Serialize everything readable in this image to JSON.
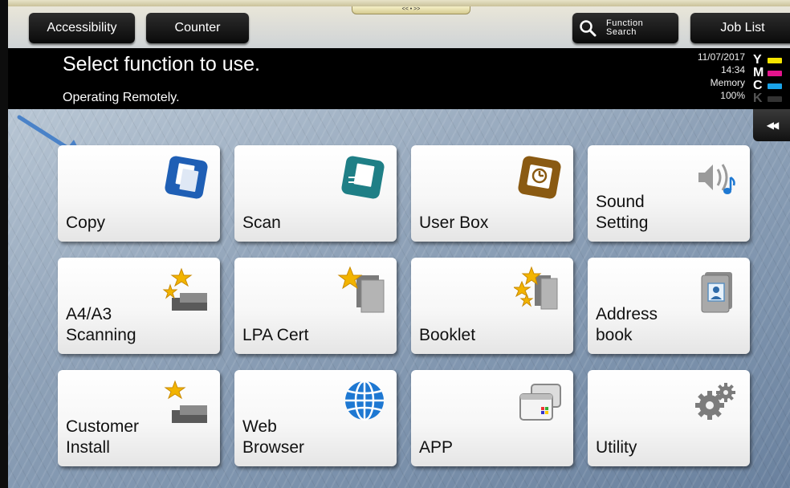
{
  "topbar": {
    "accessibility_label": "Accessibility",
    "counter_label": "Counter",
    "function_search_line1": "Function",
    "function_search_line2": "Search",
    "job_list_label": "Job List",
    "handle_glyph": "<< • >>"
  },
  "message": {
    "title": "Select function to use.",
    "subtitle": "Operating Remotely."
  },
  "status": {
    "date": "11/07/2017",
    "time": "14:34",
    "memory_label": "Memory",
    "memory_value": "100%"
  },
  "toner": [
    {
      "letter": "Y",
      "color": "#f5e400"
    },
    {
      "letter": "M",
      "color": "#e3148d"
    },
    {
      "letter": "C",
      "color": "#1aa3e8"
    },
    {
      "letter": "K",
      "color": "#333333"
    }
  ],
  "collapse_glyph": "◀◀",
  "tiles": [
    {
      "label": "Copy",
      "icon": "copy-icon"
    },
    {
      "label": "Scan",
      "icon": "scan-icon"
    },
    {
      "label": "User Box",
      "icon": "user-box-icon"
    },
    {
      "label": "Sound\nSetting",
      "icon": "speaker-icon"
    },
    {
      "label": "A4/A3\nScanning",
      "icon": "scanner-star-icon"
    },
    {
      "label": "LPA Cert",
      "icon": "document-star-icon"
    },
    {
      "label": "Booklet",
      "icon": "booklet-star-icon"
    },
    {
      "label": "Address\nbook",
      "icon": "address-book-icon"
    },
    {
      "label": "Customer\nInstall",
      "icon": "scanner-star-icon"
    },
    {
      "label": "Web\nBrowser",
      "icon": "globe-icon"
    },
    {
      "label": "APP",
      "icon": "app-windows-icon"
    },
    {
      "label": "Utility",
      "icon": "gear-icon"
    }
  ],
  "colors": {
    "copy_blue": "#1f5fb5",
    "scan_teal": "#1f7f86",
    "userbox_brown": "#8a5a12",
    "star_gold": "#f2b400",
    "globe_blue": "#1e78d2"
  }
}
